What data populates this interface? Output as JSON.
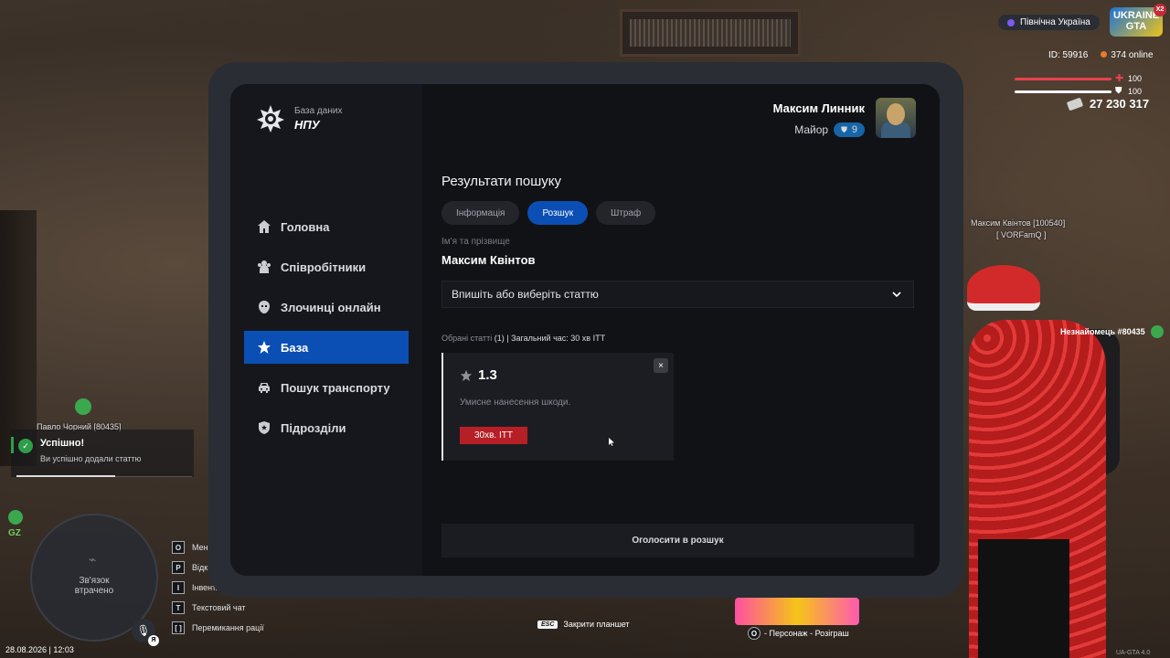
{
  "tablet": {
    "logo_subtitle": "База даних",
    "logo_title": "НПУ",
    "nav": [
      {
        "label": "Головна",
        "icon": "home-icon"
      },
      {
        "label": "Співробітники",
        "icon": "users-icon"
      },
      {
        "label": "Злочинці онлайн",
        "icon": "mask-icon"
      },
      {
        "label": "База",
        "icon": "star-icon"
      },
      {
        "label": "Пошук транспорту",
        "icon": "car-icon"
      },
      {
        "label": "Підрозділи",
        "icon": "shield-icon"
      }
    ],
    "active_nav": "База",
    "user": {
      "name": "Максим Линник",
      "rank": "Майор",
      "rank_level": "9"
    },
    "section_title": "Результати пошуку",
    "tabs": [
      "Інформація",
      "Розшук",
      "Штраф"
    ],
    "active_tab": "Розшук",
    "field_label": "Ім'я та прізвище",
    "field_value": "Максим Квінтов",
    "select_placeholder": "Впишіть або виберіть статтю",
    "chosen_label": "Обрані статті",
    "chosen_count": "(1)",
    "chosen_total": "| Загальний час: 30 хв ІТТ",
    "article": {
      "number": "1.3",
      "description": "Умисне нанесення шкоди.",
      "penalty": "30хв. ІТТ",
      "close": "×"
    },
    "wanted_button": "Оголосити в розшук"
  },
  "hud": {
    "region": "Північна Україна",
    "game_logo_line1": "UKRAINE",
    "game_logo_line2": "GTA",
    "game_logo_badge": "X2",
    "player_id": "ID: 59916",
    "online": "374 online",
    "health": "100",
    "armor": "100",
    "money": "27 230 317",
    "health_color": "#e8424c",
    "armor_color": "#ffffff",
    "nick_right": "Максим Квінтов [100540]",
    "nick_right_tag": "[ VORFamQ ]",
    "stranger": "Незнайомець #80435",
    "nick_left": "Павло Чорний [80435]",
    "notification": {
      "title": "Успішно!",
      "text": "Ви успішно додали статтю"
    },
    "gz": "GZ",
    "minimap_text_1": "Зв'язок",
    "minimap_text_2": "втрачено",
    "mic_key": "Я",
    "datetime": "28.08.2026 | 12:03",
    "keys": [
      {
        "key": "O",
        "label": "Мен"
      },
      {
        "key": "P",
        "label": "Відк"
      },
      {
        "key": "I",
        "label": "Інвент."
      },
      {
        "key": "T",
        "label": "Текстовий чат"
      },
      {
        "key": "[ ]",
        "label": "Перемикання рації"
      }
    ],
    "esc_key": "ESC",
    "esc_label": "Закрити планшет",
    "promo_label": "- Персонаж - Розіграш",
    "promo_key": "O",
    "version": "UA-GTA 4.0"
  }
}
